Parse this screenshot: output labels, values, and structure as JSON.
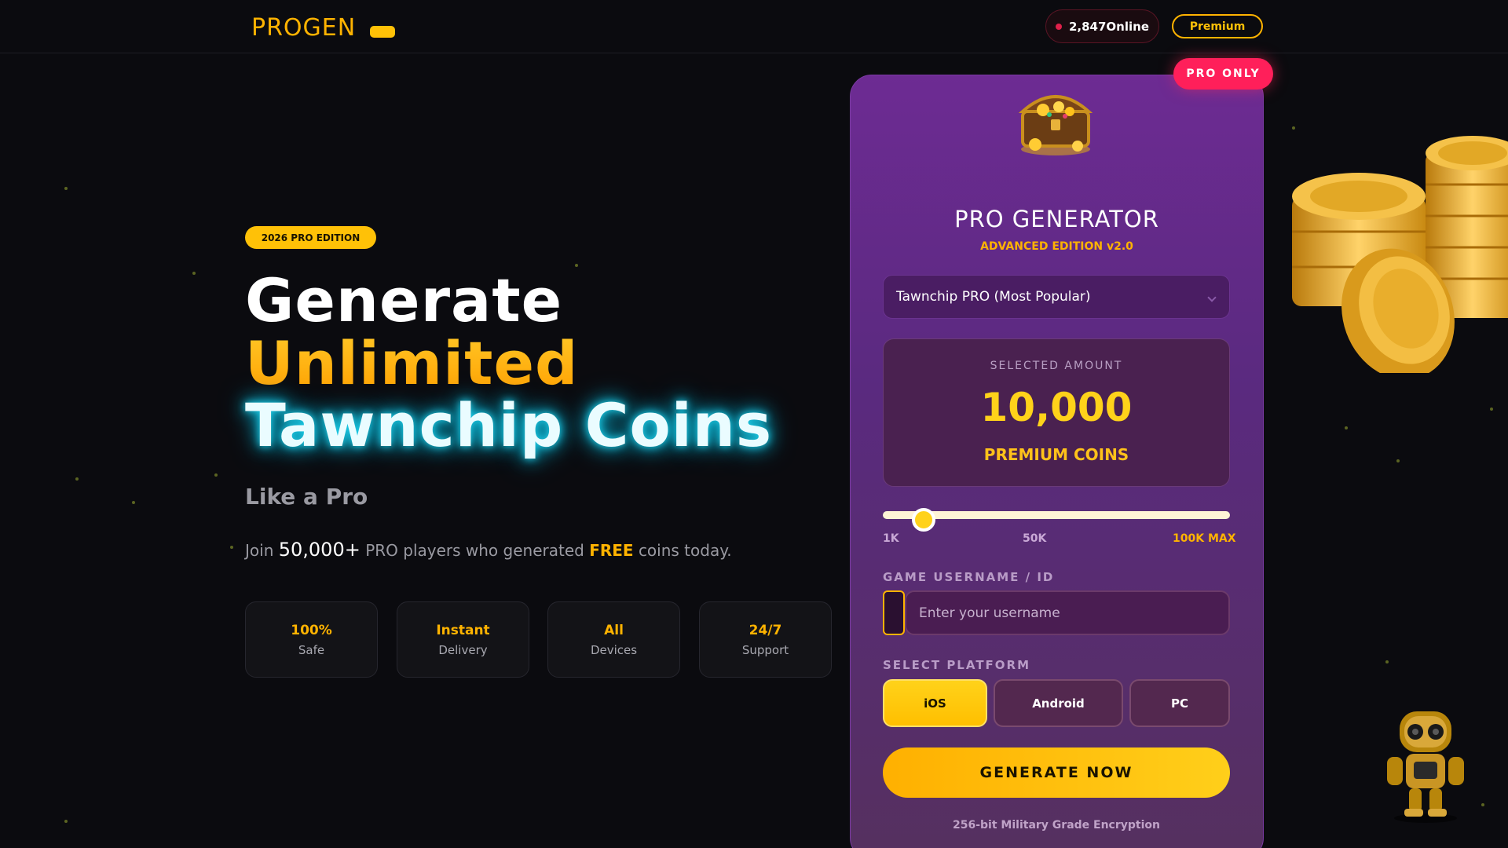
{
  "header": {
    "logo": "PROGEN",
    "online_count": "2,847Online",
    "premium_label": "Premium"
  },
  "hero": {
    "edition_badge": "2026 PRO EDITION",
    "line1": "Generate",
    "line2": "Unlimited",
    "line3": "Tawnchip Coins",
    "tagline": "Like a Pro",
    "join_prefix": "Join",
    "join_count": "50,000+",
    "join_middle": "PRO players who generated",
    "join_free": "FREE",
    "join_suffix": "coins today.",
    "features": [
      {
        "value": "100%",
        "label": "Safe"
      },
      {
        "value": "Instant",
        "label": "Delivery"
      },
      {
        "value": "All",
        "label": "Devices"
      },
      {
        "value": "24/7",
        "label": "Support"
      }
    ]
  },
  "generator": {
    "badge": "PRO ONLY",
    "title": "PRO GENERATOR",
    "subtitle": "ADVANCED EDITION v2.0",
    "package_selected": "Tawnchip PRO (Most Popular)",
    "amount_label": "SELECTED AMOUNT",
    "amount_value": "10,000",
    "amount_unit": "PREMIUM COINS",
    "slider": {
      "min_label": "1K",
      "mid_label": "50K",
      "max_label": "100K MAX",
      "value": 10000,
      "min": 1000,
      "max": 100000
    },
    "username_label": "GAME USERNAME / ID",
    "username_placeholder": "Enter your username",
    "platform_label": "SELECT PLATFORM",
    "platforms": [
      "iOS",
      "Android",
      "PC"
    ],
    "platform_selected": "iOS",
    "generate_label": "GENERATE NOW",
    "encryption_note": "256-bit Military Grade Encryption"
  },
  "colors": {
    "accent": "#ffb300",
    "background": "#0b0b0f",
    "card": "#6d2b93",
    "pro_badge": "#ff1f5a",
    "neon": "#22d3ee"
  },
  "icons": {
    "status_dot": "online-dot-icon",
    "chest": "treasure-chest-icon",
    "coins": "coin-stack-icon",
    "robot": "robot-icon",
    "dropdown": "chevron-down-icon"
  }
}
